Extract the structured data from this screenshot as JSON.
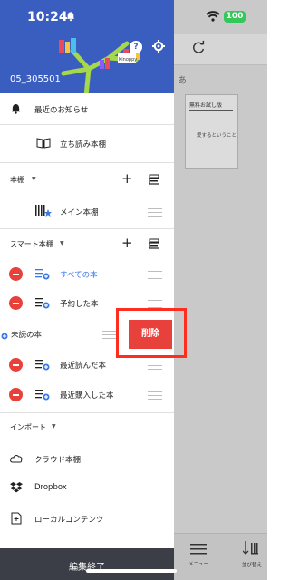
{
  "status": {
    "time": "10:24",
    "battery": "100"
  },
  "header": {
    "user_id": "05_305501",
    "help_symbol": "?",
    "logo_text": "Kinoppy"
  },
  "menu": {
    "news": "最近のお知らせ",
    "browse_shelf": "立ち読み本棚"
  },
  "bookshelf": {
    "section": "本棚",
    "main": "メイン本棚"
  },
  "smart": {
    "section": "スマート本棚",
    "items": [
      {
        "label": "すべての本",
        "accent": true
      },
      {
        "label": "予約した本",
        "accent": false
      },
      {
        "label": "未読の本",
        "accent": false
      },
      {
        "label": "最近読んだ本",
        "accent": false
      },
      {
        "label": "最近購入した本",
        "accent": false
      }
    ],
    "delete_label": "削除"
  },
  "import": {
    "section": "インポート",
    "items": [
      {
        "label": "クラウド本棚"
      },
      {
        "label": "Dropbox"
      },
      {
        "label": "ローカルコンテンツ"
      }
    ]
  },
  "footer": {
    "done": "編集終了"
  },
  "background": {
    "section_char": "あ",
    "book_title": "無料お試し版",
    "book_sub": "愛するということ",
    "menu_label": "メニュー",
    "sort_label": "並び替え"
  },
  "colors": {
    "accent": "#3a78e6",
    "delete": "#e8403a",
    "header": "#3a5ec0",
    "footer": "#3b3e46"
  }
}
